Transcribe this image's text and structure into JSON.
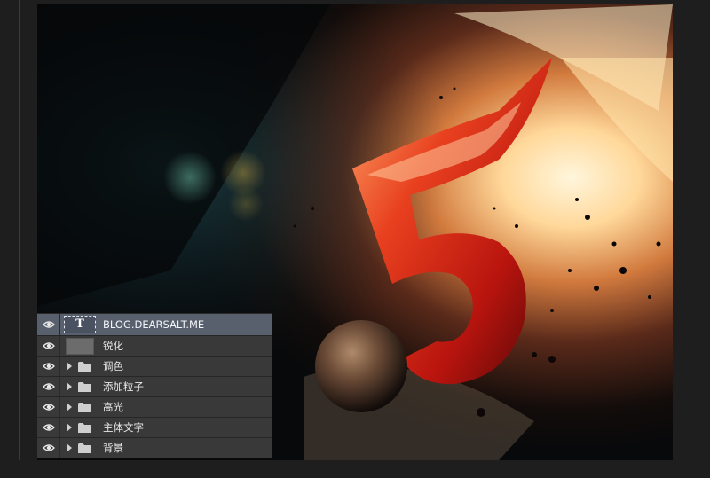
{
  "layers_panel": {
    "layers": [
      {
        "name": "BLOG.DEARSALT.ME",
        "kind": "text",
        "thumb_glyph": "T",
        "selected": true
      },
      {
        "name": "锐化",
        "kind": "pixel"
      },
      {
        "name": "调色",
        "kind": "group"
      },
      {
        "name": "添加粒子",
        "kind": "group"
      },
      {
        "name": "高光",
        "kind": "group"
      },
      {
        "name": "主体文字",
        "kind": "group"
      },
      {
        "name": "背景",
        "kind": "group"
      }
    ]
  },
  "icons": {
    "visibility": "eye-icon",
    "group": "folder-icon",
    "expand": "triangle-right-icon"
  },
  "colors": {
    "panel_bg": "#393939",
    "selected_row": "#58606e",
    "accent_rule": "#8a1a12",
    "artwork_red": "#d8281a"
  }
}
